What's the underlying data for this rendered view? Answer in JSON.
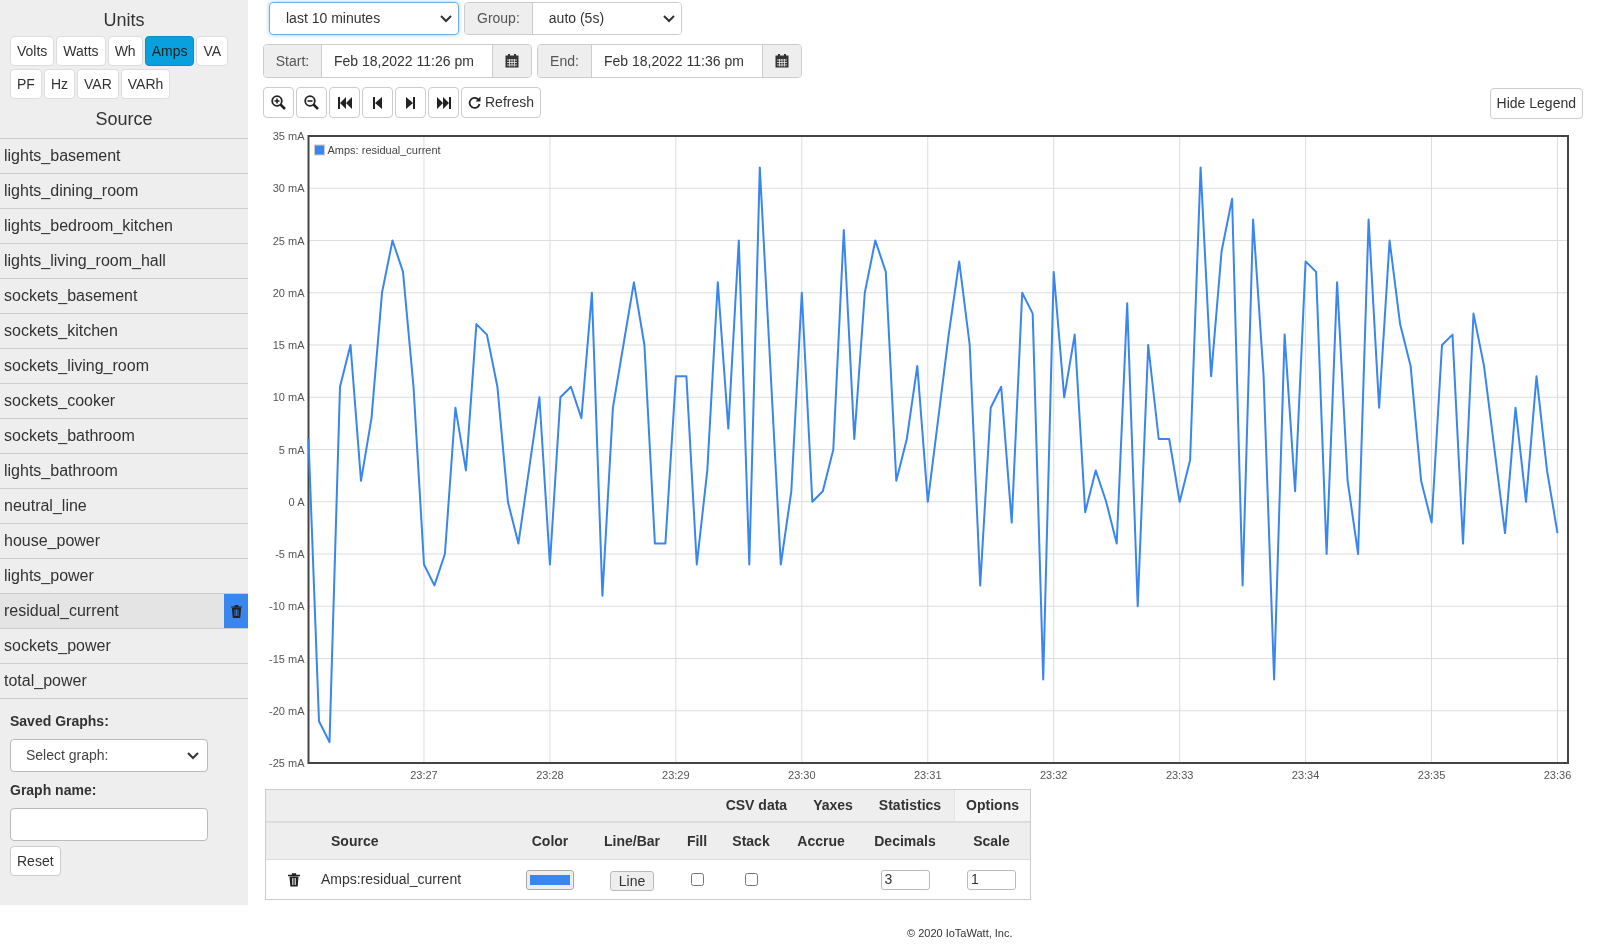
{
  "sidebar": {
    "units_title": "Units",
    "units": [
      {
        "label": "Volts",
        "selected": false
      },
      {
        "label": "Watts",
        "selected": false
      },
      {
        "label": "Wh",
        "selected": false
      },
      {
        "label": "Amps",
        "selected": true
      },
      {
        "label": "VA",
        "selected": false
      },
      {
        "label": "PF",
        "selected": false
      },
      {
        "label": "Hz",
        "selected": false
      },
      {
        "label": "VAR",
        "selected": false
      },
      {
        "label": "VARh",
        "selected": false
      }
    ],
    "source_title": "Source",
    "sources": [
      {
        "label": "lights_basement",
        "selected": false
      },
      {
        "label": "lights_dining_room",
        "selected": false
      },
      {
        "label": "lights_bedroom_kitchen",
        "selected": false
      },
      {
        "label": "lights_living_room_hall",
        "selected": false
      },
      {
        "label": "sockets_basement",
        "selected": false
      },
      {
        "label": "sockets_kitchen",
        "selected": false
      },
      {
        "label": "sockets_living_room",
        "selected": false
      },
      {
        "label": "sockets_cooker",
        "selected": false
      },
      {
        "label": "sockets_bathroom",
        "selected": false
      },
      {
        "label": "lights_bathroom",
        "selected": false
      },
      {
        "label": "neutral_line",
        "selected": false
      },
      {
        "label": "house_power",
        "selected": false
      },
      {
        "label": "lights_power",
        "selected": false
      },
      {
        "label": "residual_current",
        "selected": true
      },
      {
        "label": "sockets_power",
        "selected": false
      },
      {
        "label": "total_power",
        "selected": false
      }
    ],
    "saved_graphs_label": "Saved Graphs:",
    "saved_graph_select": "Select graph:",
    "graph_name_label": "Graph name:",
    "reset_button": "Reset"
  },
  "controls": {
    "period": "last 10 minutes",
    "group_label": "Group:",
    "group": "auto (5s)",
    "start_label": "Start:",
    "start": "Feb 18,2022 11:26 pm",
    "end_label": "End:",
    "end": "Feb 18,2022 11:36 pm",
    "refresh_button": "Refresh",
    "legend_button": "Hide Legend"
  },
  "chart": {
    "chart_data": {
      "type": "line",
      "grid": true,
      "ylim": [
        -25,
        35
      ],
      "yticks": [
        {
          "value": 35,
          "label": "35 mA"
        },
        {
          "value": 30,
          "label": "30 mA"
        },
        {
          "value": 25,
          "label": "25 mA"
        },
        {
          "value": 20,
          "label": "20 mA"
        },
        {
          "value": 15,
          "label": "15 mA"
        },
        {
          "value": 10,
          "label": "10 mA"
        },
        {
          "value": 5,
          "label": "5 mA"
        },
        {
          "value": 0,
          "label": "0 A"
        },
        {
          "value": -5,
          "label": "-5 mA"
        },
        {
          "value": -10,
          "label": "-10 mA"
        },
        {
          "value": -15,
          "label": "-15 mA"
        },
        {
          "value": -20,
          "label": "-20 mA"
        },
        {
          "value": -25,
          "label": "-25 mA"
        }
      ],
      "categories": [
        null,
        null,
        null,
        null,
        null,
        null,
        null,
        null,
        null,
        null,
        null,
        "23:27",
        null,
        null,
        null,
        null,
        null,
        null,
        null,
        null,
        null,
        null,
        null,
        "23:28",
        null,
        null,
        null,
        null,
        null,
        null,
        null,
        null,
        null,
        null,
        null,
        "23:29",
        null,
        null,
        null,
        null,
        null,
        null,
        null,
        null,
        null,
        null,
        null,
        "23:30",
        null,
        null,
        null,
        null,
        null,
        null,
        null,
        null,
        null,
        null,
        null,
        "23:31",
        null,
        null,
        null,
        null,
        null,
        null,
        null,
        null,
        null,
        null,
        null,
        "23:32",
        null,
        null,
        null,
        null,
        null,
        null,
        null,
        null,
        null,
        null,
        null,
        "23:33",
        null,
        null,
        null,
        null,
        null,
        null,
        null,
        null,
        null,
        null,
        null,
        "23:34",
        null,
        null,
        null,
        null,
        null,
        null,
        null,
        null,
        null,
        null,
        null,
        "23:35",
        null,
        null,
        null,
        null,
        null,
        null,
        null,
        null,
        null,
        null,
        null,
        "23:36"
      ],
      "series": [
        {
          "name": "Amps: residual_current",
          "color": "#3a86f0",
          "values": [
            6,
            -21,
            -23,
            11,
            15,
            2,
            8,
            20,
            25,
            22,
            11,
            -6,
            -8,
            -5,
            9,
            3,
            17,
            16,
            11,
            0,
            -4,
            3,
            10,
            -6,
            10,
            11,
            8,
            20,
            -9,
            9,
            15,
            21,
            15,
            -4,
            -4,
            12,
            12,
            -6,
            3,
            21,
            7,
            25,
            -6,
            32,
            13,
            -6,
            1,
            20,
            0,
            1,
            5,
            26,
            6,
            20,
            25,
            22,
            2,
            6,
            13,
            0,
            8,
            16,
            23,
            15,
            -8,
            9,
            11,
            -2,
            20,
            18,
            -17,
            22,
            10,
            16,
            -1,
            3,
            0,
            -4,
            19,
            -10,
            15,
            6,
            6,
            0,
            4,
            32,
            12,
            24,
            29,
            -8,
            27,
            12,
            -17,
            16,
            1,
            23,
            22,
            -5,
            21,
            2,
            -5,
            27,
            9,
            25,
            17,
            13,
            2,
            -2,
            15,
            16,
            -4,
            18,
            13,
            5,
            -3,
            9,
            0,
            12,
            3,
            -3
          ]
        }
      ]
    }
  },
  "table": {
    "tabs": [
      {
        "label": "CSV data",
        "selected": false
      },
      {
        "label": "Yaxes",
        "selected": false
      },
      {
        "label": "Statistics",
        "selected": false
      },
      {
        "label": "Options",
        "selected": true
      }
    ],
    "columns": [
      "Source",
      "Color",
      "Line/Bar",
      "Fill",
      "Stack",
      "Accrue",
      "Decimals",
      "Scale"
    ],
    "rows": [
      {
        "source": "Amps:residual_current",
        "color": "#3a86f0",
        "line_bar": "Line",
        "fill": false,
        "stack": false,
        "decimals": "3",
        "scale": "1"
      }
    ]
  },
  "footer": "© 2020 IoTaWatt, Inc."
}
